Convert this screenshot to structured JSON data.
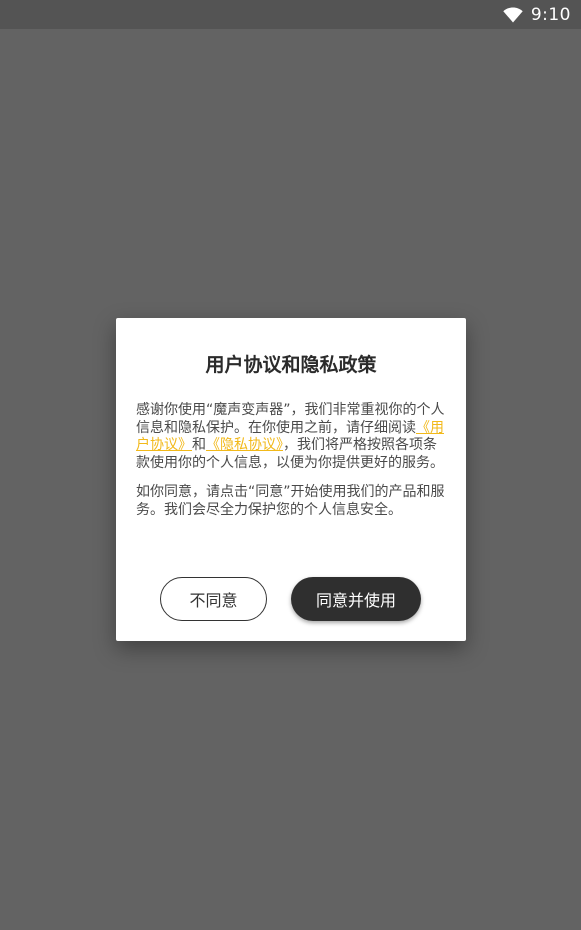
{
  "status_bar": {
    "time": "9:10",
    "wifi_icon": "wifi-icon"
  },
  "dialog": {
    "title": "用户协议和隐私政策",
    "para1_part1": "感谢你使用“魔声变声器”，我们非常重视你的个人信息和隐私保护。在你使用之前，请仔细阅读",
    "user_agreement_link": "《用户协议》",
    "para1_and": "和",
    "privacy_link": "《隐私协议》",
    "para1_part2": "，我们将严格按照各项条款使用你的个人信息，以便为你提供更好的服务。",
    "para2": "如你同意，请点击“同意”开始使用我们的产品和服务。我们会尽全力保护您的个人信息安全。",
    "disagree_label": "不同意",
    "agree_label": "同意并使用"
  },
  "colors": {
    "overlay": "#636363",
    "status_bar": "#545454",
    "link": "#f2b91a",
    "primary_button": "#2f2f2f"
  }
}
